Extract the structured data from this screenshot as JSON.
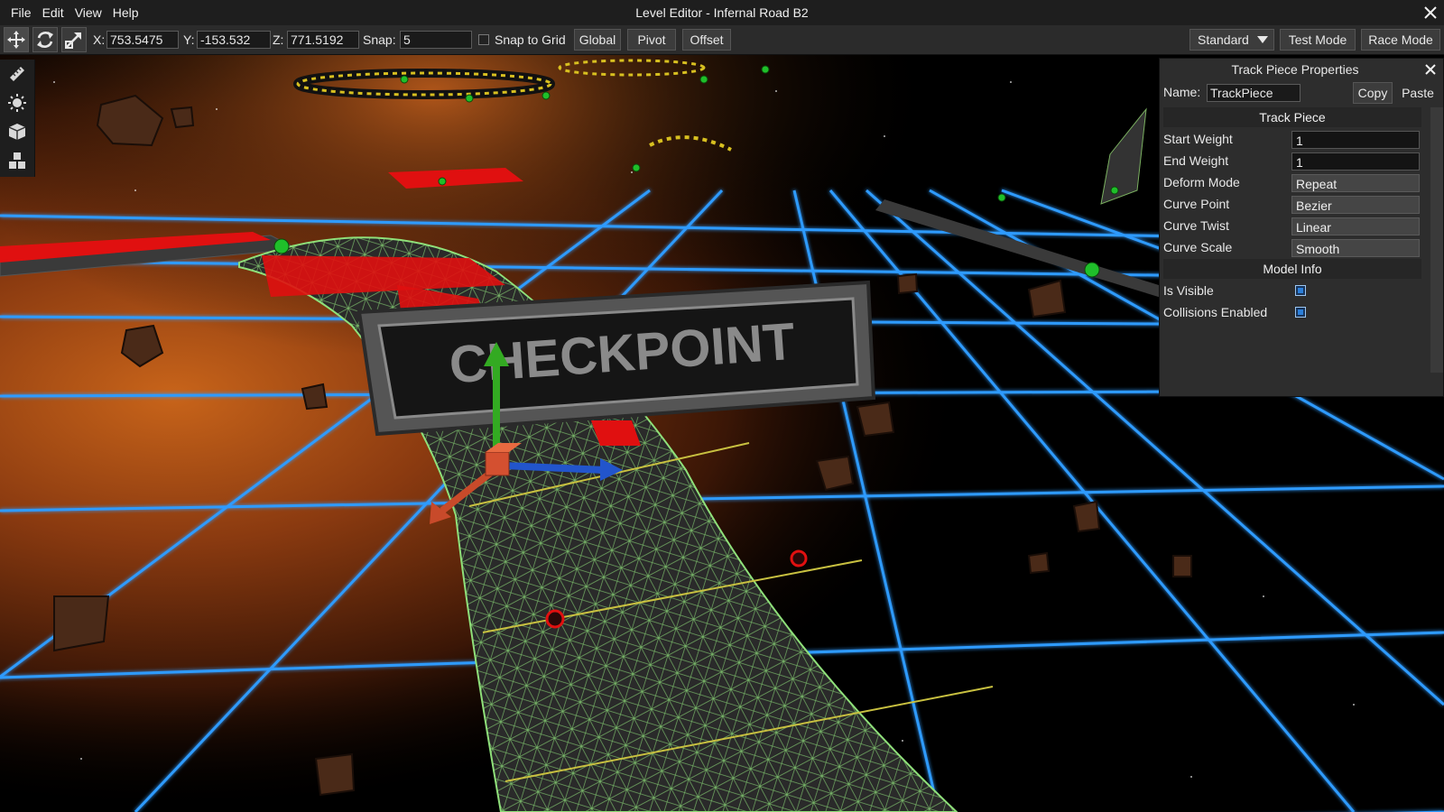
{
  "menu": {
    "items": [
      "File",
      "Edit",
      "View",
      "Help"
    ]
  },
  "window": {
    "title": "Level Editor - Infernal Road B2"
  },
  "toolbar": {
    "x_label": "X:",
    "x_value": "753.5475",
    "y_label": "Y:",
    "y_value": "-153.532",
    "z_label": "Z:",
    "z_value": "771.5192",
    "snap_label": "Snap:",
    "snap_value": "5",
    "snap_to_grid_label": "Snap to Grid",
    "global_label": "Global",
    "pivot_label": "Pivot",
    "offset_label": "Offset",
    "mode_selected": "Standard",
    "test_mode_label": "Test Mode",
    "race_mode_label": "Race Mode"
  },
  "scene": {
    "checkpoint_label": "CHECKPOINT"
  },
  "properties": {
    "title": "Track Piece Properties",
    "name_label": "Name:",
    "name_value": "TrackPiece",
    "copy_label": "Copy",
    "paste_label": "Paste",
    "track_section": "Track Piece",
    "rows": [
      {
        "label": "Start Weight",
        "value": "1"
      },
      {
        "label": "End Weight",
        "value": "1"
      },
      {
        "label": "Deform Mode",
        "value": "Repeat"
      },
      {
        "label": "Curve Point",
        "value": "Bezier"
      },
      {
        "label": "Curve Twist",
        "value": "Linear"
      },
      {
        "label": "Curve Scale",
        "value": "Smooth"
      }
    ],
    "model_section": "Model Info",
    "is_visible_label": "Is Visible",
    "collisions_label": "Collisions Enabled"
  },
  "colors": {
    "grid": "#2f9bff",
    "accent_red": "#e01010",
    "checkbox": "#2b7fd9",
    "panel_bg": "#2d2d2d"
  }
}
